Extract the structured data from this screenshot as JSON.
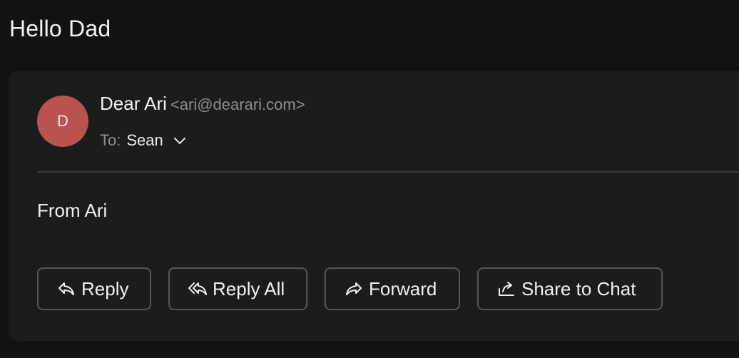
{
  "email": {
    "subject": "Hello Dad",
    "sender": {
      "avatar_initial": "D",
      "avatar_color": "#b85350",
      "name": "Dear Ari",
      "email": "<ari@dearari.com>"
    },
    "recipients": {
      "label": "To:",
      "value": "Sean",
      "expand_icon": "chevron-down-icon"
    },
    "body": "From Ari"
  },
  "actions": {
    "reply_label": "Reply",
    "reply_all_label": "Reply All",
    "forward_label": "Forward",
    "share_label": "Share to Chat"
  },
  "colors": {
    "background": "#121212",
    "card": "#1c1c1c",
    "button_border": "#555555",
    "muted_text": "#8e8e8e"
  }
}
